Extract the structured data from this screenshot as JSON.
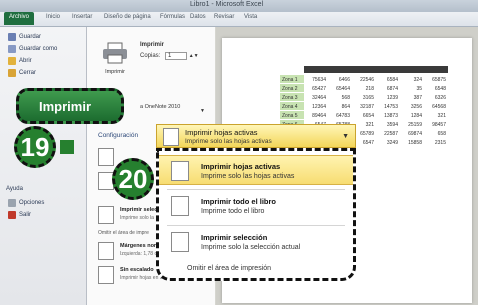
{
  "window": {
    "title": "Libro1 - Microsoft Excel"
  },
  "ribbon_tabs": [
    {
      "label": "Archivo"
    },
    {
      "label": "Inicio"
    },
    {
      "label": "Insertar"
    },
    {
      "label": "Diseño de página"
    },
    {
      "label": "Fórmulas"
    },
    {
      "label": "Datos"
    },
    {
      "label": "Revisar"
    },
    {
      "label": "Vista"
    }
  ],
  "nav": {
    "items": [
      {
        "label": "Guardar"
      },
      {
        "label": "Guardar como"
      },
      {
        "label": "Abrir"
      },
      {
        "label": "Cerrar"
      }
    ],
    "help": "Ayuda",
    "options": "Opciones",
    "exit": "Salir"
  },
  "print": {
    "big_button": "Imprimir",
    "heading": "Imprimir",
    "button_label": "Imprimir",
    "copies_label": "Copias:",
    "copies_value": "1",
    "printer_text": "a OneNote 2010",
    "config_label": "Configuración"
  },
  "badges": {
    "step19": "19",
    "step20": "20"
  },
  "combo": {
    "title": "Imprimir hojas activas",
    "subtitle": "Imprime solo las hojas activas"
  },
  "options": [
    {
      "title": "Imprimir hojas activas",
      "subtitle": "Imprime solo las hojas activas"
    },
    {
      "title": "Imprimir todo el libro",
      "subtitle": "Imprime todo el libro"
    },
    {
      "title": "Imprimir selección",
      "subtitle": "Imprime solo la selección actual"
    }
  ],
  "omit_label": "Omitir el área de impresión",
  "left_partial": {
    "sel_title": "Imprimir selección",
    "sel_sub": "Imprime solo la",
    "omit": "Omitir el área de impre",
    "margins_title": "Márgenes normales",
    "margins_sub": "Izquierda: 1,78 cm",
    "nosc_title": "Sin escalado",
    "nosc_sub": "Imprimir hojas en su"
  },
  "preview_rows": [
    {
      "label": "Zona 1",
      "values": [
        "75634",
        "6466",
        "22546",
        "6584",
        "324",
        "65875"
      ]
    },
    {
      "label": "Zona 2",
      "values": [
        "65427",
        "65464",
        "218",
        "6874",
        "35",
        "6548"
      ]
    },
    {
      "label": "Zona 3",
      "values": [
        "32464",
        "568",
        "3165",
        "1239",
        "387",
        "6326"
      ]
    },
    {
      "label": "Zona 4",
      "values": [
        "12364",
        "864",
        "32187",
        "14753",
        "3256",
        "64568"
      ]
    },
    {
      "label": "Zona 5",
      "values": [
        "89464",
        "64783",
        "6654",
        "13873",
        "1284",
        "321"
      ]
    },
    {
      "label": "Zona 6",
      "values": [
        "6547",
        "65788",
        "321",
        "3594",
        "25159",
        "98457"
      ]
    },
    {
      "label": "Zona 7",
      "values": [
        "9847",
        "65478",
        "65789",
        "22587",
        "69874",
        "658"
      ]
    },
    {
      "label": "Zona 8",
      "values": [
        "1231",
        "2465",
        "6547",
        "3249",
        "15858",
        "2315"
      ]
    }
  ],
  "colors": {
    "excel_green": "#1f6e3f",
    "highlight": "#f7dd72"
  }
}
